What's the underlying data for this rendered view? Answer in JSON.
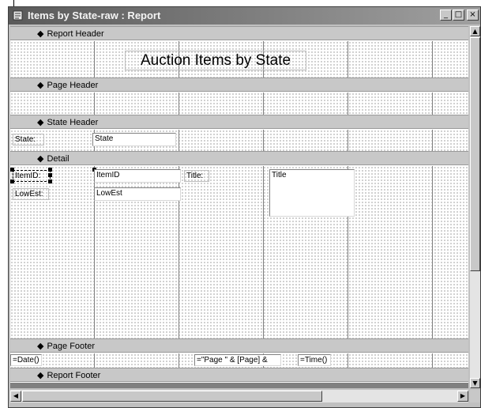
{
  "window": {
    "title": "Items by State-raw : Report",
    "title_icon": "report-icon",
    "buttons": [
      {
        "name": "minimize",
        "glyph": "_"
      },
      {
        "name": "maximize",
        "glyph": "□"
      },
      {
        "name": "close",
        "glyph": "×"
      }
    ]
  },
  "sections": {
    "report_header": "Report Header",
    "page_header": "Page Header",
    "state_header": "State Header",
    "detail": "Detail",
    "page_footer": "Page Footer",
    "report_footer": "Report Footer",
    "band_icon": "section-band-icon"
  },
  "report_header": {
    "title": "Auction Items by State"
  },
  "state_header": {
    "state_label": "State:",
    "state_field": "State"
  },
  "detail": {
    "itemid_label": "ItemID:",
    "itemid_field": "ItemID",
    "lowest_label": "LowEst:",
    "lowest_field": "LowEst",
    "title_label": "Title:",
    "title_field": "Title"
  },
  "page_footer": {
    "date_field": "=Date()",
    "page_field": "=\"Page \" & [Page] &",
    "time_field": "=Time()"
  },
  "colors": {
    "titlebar": "#5a5a5a",
    "band": "#c8c8c8",
    "grid_line": "#808080"
  }
}
